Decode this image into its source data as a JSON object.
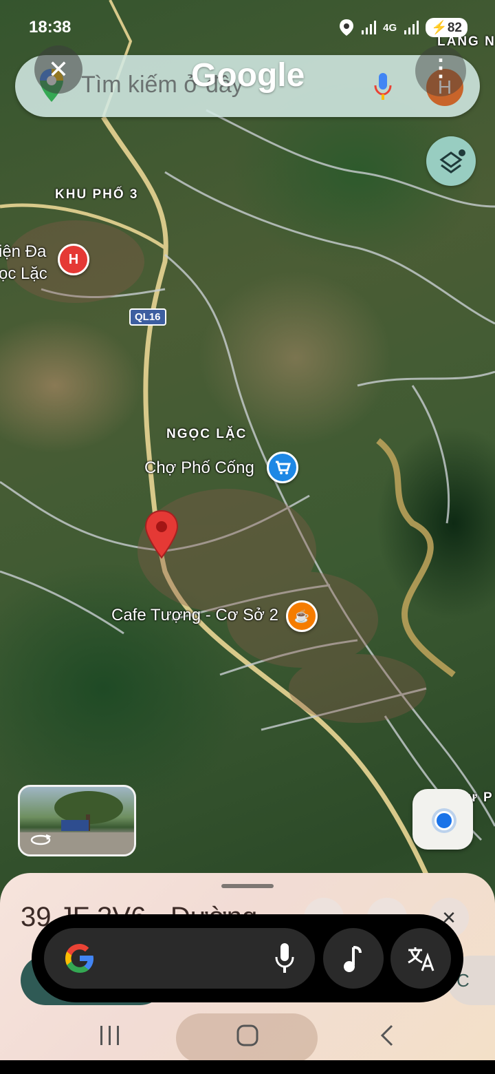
{
  "status_bar": {
    "time": "18:38",
    "network": "4G",
    "battery": "82"
  },
  "search": {
    "placeholder": "Tìm kiếm ở đây",
    "google_wordmark": "Google",
    "avatar_letter": "H",
    "close_symbol": "✕",
    "menu_symbol": "⋮"
  },
  "map": {
    "labels": {
      "top_right_area": "LÀNG N",
      "khu_pho": "KHU PHỐ 3",
      "hospital_line1": "iện Đa",
      "hospital_line2": "ọc Lặc",
      "road_shield": "QL16",
      "district": "NGỌC LẶC",
      "market": "Chợ Phố Cống",
      "cafe": "Cafe Tượng - Cơ Sở 2",
      "bottom_right_area": "ự P"
    },
    "poi_symbols": {
      "hospital": "H",
      "cafe": "☕"
    }
  },
  "bottom_sheet": {
    "place_title": "39 JF 3V6 - Đường",
    "close_symbol": "✕",
    "share_label": "C"
  },
  "colors": {
    "pin_red": "#e53935",
    "market_blue": "#1e88e5",
    "cafe_orange": "#f57c00",
    "hospital_red": "#e53935",
    "road_yellow": "#d8c98a",
    "location_blue": "#1a73e8"
  },
  "icons": {
    "close": "close-icon",
    "menu": "more-vert-icon",
    "layers": "layers-icon",
    "mic": "mic-icon",
    "music": "music-note-icon",
    "translate": "translate-icon",
    "my_location": "my-location-icon",
    "google_g": "google-g-icon"
  }
}
